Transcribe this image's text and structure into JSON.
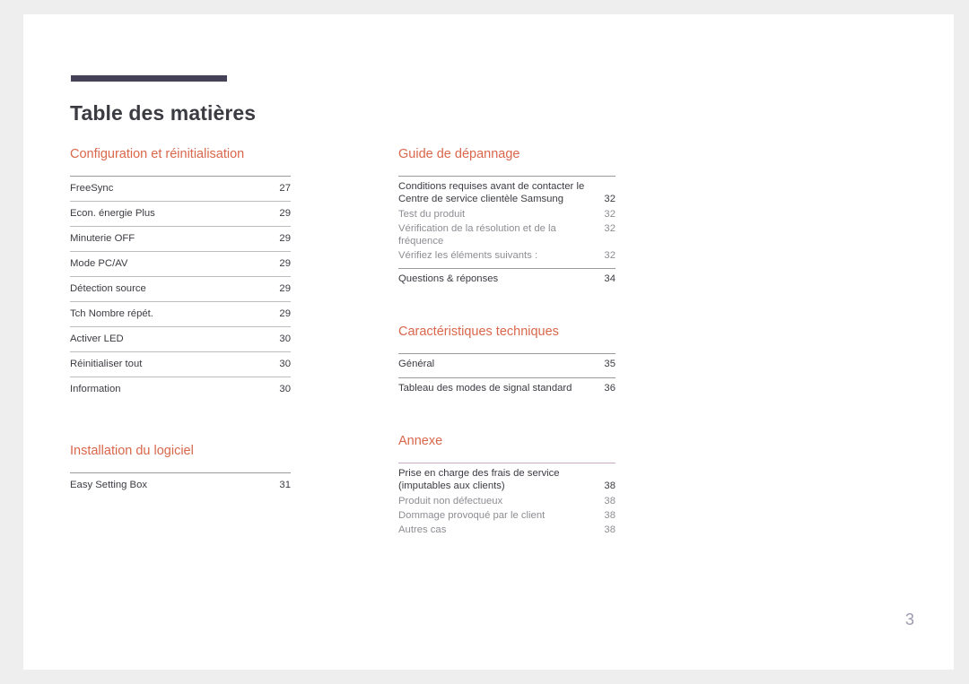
{
  "document": {
    "title": "Table des matières",
    "folio": "3",
    "accent_color": "#d9674b",
    "title_bar_color": "#454156",
    "rule_color": "#9b9b9b",
    "mauve_rule_color": "#c9a9c6",
    "folio_color": "#9d9bae",
    "page_background": "#ffffff",
    "canvas_background": "#efeeee"
  },
  "columns": {
    "left": [
      {
        "id": "configuration-et-reinitialisation",
        "heading": "Configuration et réinitialisation",
        "style": "ruled",
        "rule": "gray",
        "entries": [
          {
            "label": "FreeSync",
            "page": "27",
            "level": 1
          },
          {
            "label": "Econ. énergie Plus",
            "page": "29",
            "level": 1
          },
          {
            "label": "Minuterie OFF",
            "page": "29",
            "level": 1
          },
          {
            "label": "Mode PC/AV",
            "page": "29",
            "level": 1
          },
          {
            "label": "Détection source",
            "page": "29",
            "level": 1
          },
          {
            "label": "Tch Nombre répét.",
            "page": "29",
            "level": 1
          },
          {
            "label": "Activer LED",
            "page": "30",
            "level": 1
          },
          {
            "label": "Réinitialiser tout",
            "page": "30",
            "level": 1
          },
          {
            "label": "Information",
            "page": "30",
            "level": 1
          }
        ]
      },
      {
        "id": "installation-du-logiciel",
        "heading": "Installation du logiciel",
        "style": "ruled",
        "rule": "gray",
        "entries": [
          {
            "label": "Easy Setting Box",
            "page": "31",
            "level": 1
          }
        ]
      }
    ],
    "right": [
      {
        "id": "guide-de-depannage",
        "heading": "Guide de dépannage",
        "style": "grouped",
        "rule": "gray",
        "groups": [
          {
            "entries": [
              {
                "label": "Conditions requises avant de contacter le",
                "label2": "Centre de service clientèle Samsung",
                "page": "32",
                "level": 1,
                "wrapped": true
              },
              {
                "label": "Test du produit",
                "page": "32",
                "level": 2
              },
              {
                "label": "Vérification de la résolution et de la fréquence",
                "page": "32",
                "level": 2
              },
              {
                "label": "Vérifiez les éléments suivants :",
                "page": "32",
                "level": 2
              }
            ]
          },
          {
            "entries": [
              {
                "label": "Questions & réponses",
                "page": "34",
                "level": 1
              }
            ]
          }
        ]
      },
      {
        "id": "caracteristiques-techniques",
        "heading": "Caractéristiques techniques",
        "style": "grouped",
        "rule": "gray",
        "groups": [
          {
            "entries": [
              {
                "label": "Général",
                "page": "35",
                "level": 1
              }
            ]
          },
          {
            "entries": [
              {
                "label": "Tableau des modes de signal standard",
                "page": "36",
                "level": 1
              }
            ]
          }
        ]
      },
      {
        "id": "annexe",
        "heading": "Annexe",
        "style": "grouped",
        "rule": "mauve",
        "groups": [
          {
            "entries": [
              {
                "label": "Prise en charge des frais de service",
                "label2": "(imputables aux clients)",
                "page": "38",
                "level": 1,
                "wrapped": true
              },
              {
                "label": "Produit non défectueux",
                "page": "38",
                "level": 2
              },
              {
                "label": "Dommage provoqué par le client",
                "page": "38",
                "level": 2
              },
              {
                "label": "Autres cas",
                "page": "38",
                "level": 2
              }
            ]
          }
        ]
      }
    ]
  }
}
